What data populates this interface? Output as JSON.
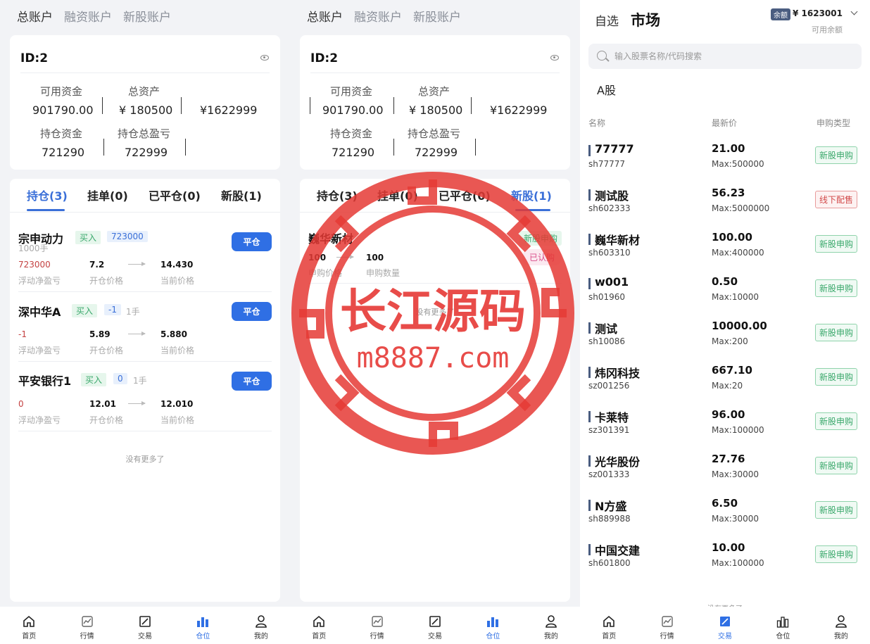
{
  "account_tabs": [
    "总账户",
    "融资账户",
    "新股账户"
  ],
  "account": {
    "id_label": "ID:2",
    "available_label": "可用资金",
    "available_value": "901790.00",
    "total_assets_label": "总资产",
    "total_assets_value": "¥ 180500",
    "extra_value": "¥1622999",
    "holding_label": "持仓资金",
    "holding_value": "721290",
    "pnl_label": "持仓总盈亏",
    "pnl_value": "722999"
  },
  "position_tabs": [
    "持仓(3)",
    "挂单(0)",
    "已平仓(0)",
    "新股(1)"
  ],
  "holdings": [
    {
      "name": "宗申动力",
      "side": "买入",
      "qty": "723000",
      "lots": "1000手",
      "pnl": "723000",
      "open_price": "7.2",
      "cur_price": "14.430"
    },
    {
      "name": "深中华A",
      "side": "买入",
      "qty": "-1",
      "lots": "1手",
      "pnl": "-1",
      "open_price": "5.89",
      "cur_price": "5.880"
    },
    {
      "name": "平安银行1",
      "side": "买入",
      "qty": "0",
      "lots": "1手",
      "pnl": "0",
      "open_price": "12.01",
      "cur_price": "12.010"
    }
  ],
  "holding_labels": {
    "pnl": "浮动净盈亏",
    "open": "开仓价格",
    "cur": "当前价格",
    "close_btn": "平仓"
  },
  "no_more": "没有更多了",
  "ipo": {
    "name": "巍华新材",
    "badge1": "新股申购",
    "badge2": "已认购",
    "price": "100",
    "qty": "100",
    "price_label": "申购价格",
    "qty_label": "申购数量"
  },
  "nav": [
    "首页",
    "行情",
    "交易",
    "仓位",
    "我的"
  ],
  "market": {
    "tab_watch": "自选",
    "tab_market": "市场",
    "balance_badge": "余额",
    "balance_value": "¥ 1623001",
    "balance_label": "可用余额",
    "search_placeholder": "输入股票名称/代码搜索",
    "section": "A股",
    "col_name": "名称",
    "col_price": "最新价",
    "col_type": "申购类型",
    "rows": [
      {
        "name": "77777",
        "code": "sh77777",
        "price": "21.00",
        "max": "Max:500000",
        "type": "新股申购",
        "color": "green"
      },
      {
        "name": "测试股",
        "code": "sh602333",
        "price": "56.23",
        "max": "Max:5000000",
        "type": "线下配售",
        "color": "red"
      },
      {
        "name": "巍华新材",
        "code": "sh603310",
        "price": "100.00",
        "max": "Max:400000",
        "type": "新股申购",
        "color": "green"
      },
      {
        "name": "w001",
        "code": "sh01960",
        "price": "0.50",
        "max": "Max:10000",
        "type": "新股申购",
        "color": "green"
      },
      {
        "name": "测试",
        "code": "sh10086",
        "price": "10000.00",
        "max": "Max:200",
        "type": "新股申购",
        "color": "green"
      },
      {
        "name": "炜冈科技",
        "code": "sz001256",
        "price": "667.10",
        "max": "Max:20",
        "type": "新股申购",
        "color": "green"
      },
      {
        "name": "卡莱特",
        "code": "sz301391",
        "price": "96.00",
        "max": "Max:100000",
        "type": "新股申购",
        "color": "green"
      },
      {
        "name": "光华股份",
        "code": "sz001333",
        "price": "27.76",
        "max": "Max:30000",
        "type": "新股申购",
        "color": "green"
      },
      {
        "name": "N方盛",
        "code": "sh889988",
        "price": "6.50",
        "max": "Max:30000",
        "type": "新股申购",
        "color": "green"
      },
      {
        "name": "中国交建",
        "code": "sh601800",
        "price": "10.00",
        "max": "Max:100000",
        "type": "新股申购",
        "color": "green"
      }
    ],
    "no_more": "没有更多了"
  },
  "watermark": {
    "line1": "长江源码",
    "line2": "m8887.com"
  }
}
